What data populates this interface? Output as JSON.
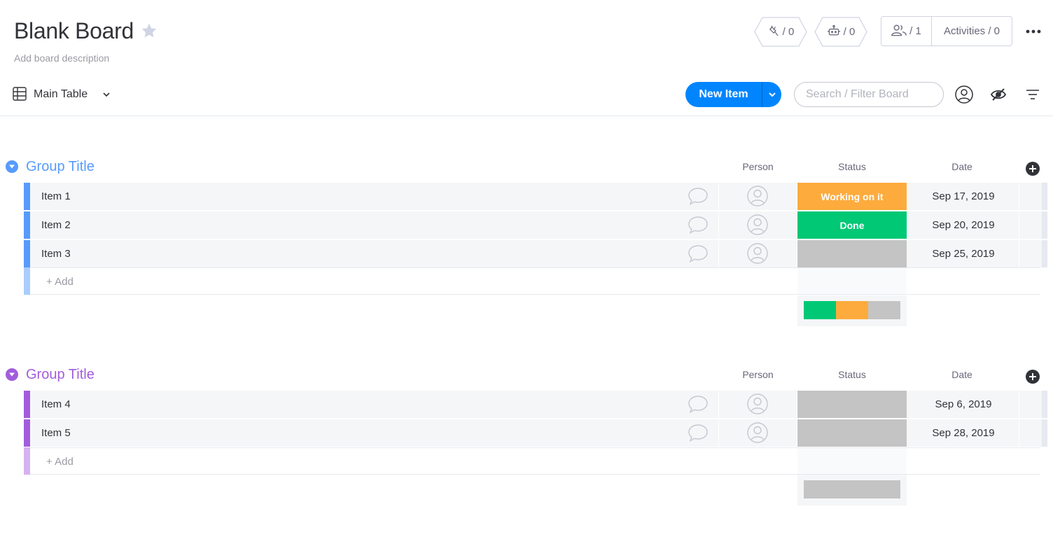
{
  "header": {
    "title": "Blank Board",
    "description_placeholder": "Add board description",
    "integrations_count": "/ 0",
    "automations_count": "/ 0",
    "members_count": "/ 1",
    "activities_label": "Activities / 0"
  },
  "toolbar": {
    "view_label": "Main Table",
    "new_item_label": "New Item",
    "search_placeholder": "Search / Filter Board"
  },
  "columns": {
    "person": "Person",
    "status": "Status",
    "date": "Date"
  },
  "groups": [
    {
      "title": "Group Title",
      "color": "#579bfc",
      "light_color": "#a9cdfd",
      "items": [
        {
          "name": "Item 1",
          "status": "Working on it",
          "status_color": "#fdab3d",
          "date": "Sep 17, 2019"
        },
        {
          "name": "Item 2",
          "status": "Done",
          "status_color": "#00c875",
          "date": "Sep 20, 2019"
        },
        {
          "name": "Item 3",
          "status": "",
          "status_color": "#c4c4c4",
          "date": "Sep 25, 2019"
        }
      ],
      "add_label": "+ Add",
      "summary": [
        {
          "color": "#00c875",
          "fraction": 0.3333
        },
        {
          "color": "#fdab3d",
          "fraction": 0.3333
        },
        {
          "color": "#c4c4c4",
          "fraction": 0.3334
        }
      ]
    },
    {
      "title": "Group Title",
      "color": "#a25ddc",
      "light_color": "#d5b2f0",
      "items": [
        {
          "name": "Item 4",
          "status": "",
          "status_color": "#c4c4c4",
          "date": "Sep 6, 2019"
        },
        {
          "name": "Item 5",
          "status": "",
          "status_color": "#c4c4c4",
          "date": "Sep 28, 2019"
        }
      ],
      "add_label": "+ Add",
      "summary": [
        {
          "color": "#c4c4c4",
          "fraction": 1.0
        }
      ]
    }
  ],
  "icons": {
    "favorite": "star-icon",
    "integrations": "plug-icon",
    "automations": "robot-icon",
    "members": "people-icon",
    "more": "more-dots-icon",
    "table_view": "table-icon",
    "person_filter": "person-circle-icon",
    "hide_columns": "eye-slash-icon",
    "filter": "filter-icon",
    "updates": "chat-bubble-icon",
    "person": "person-avatar-icon",
    "add_column": "plus-circle-icon"
  }
}
